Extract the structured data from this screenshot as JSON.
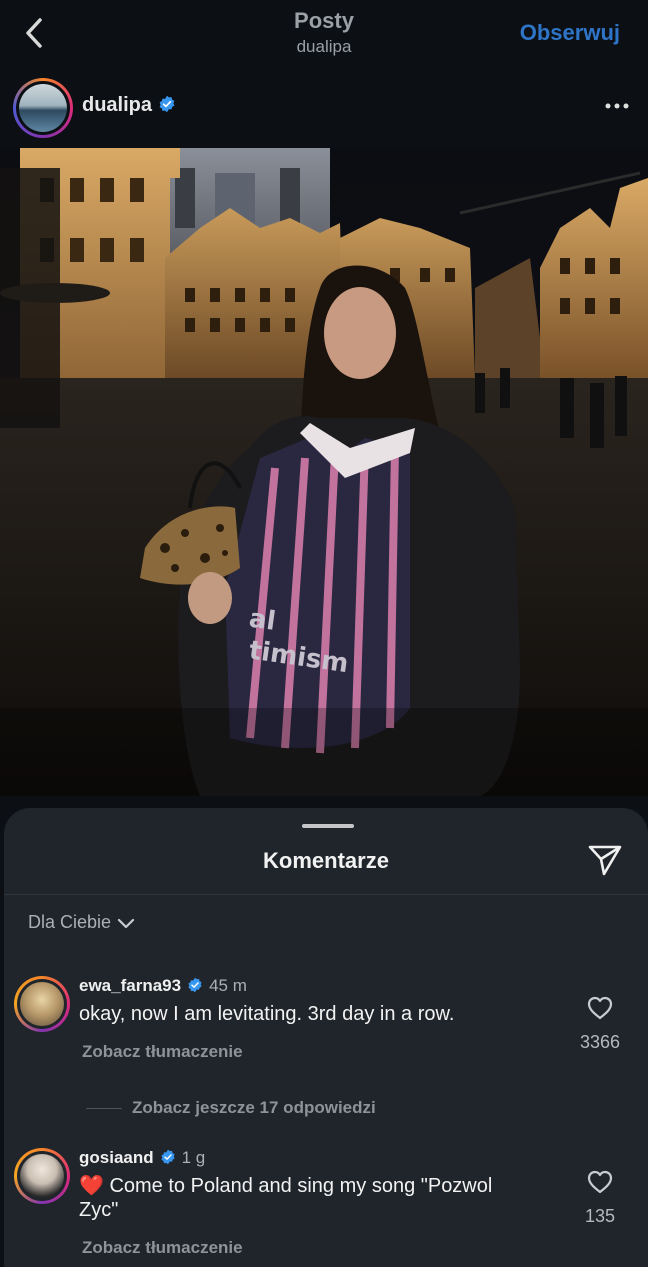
{
  "topbar": {
    "title": "Posty",
    "subtitle": "dualipa",
    "follow_label": "Obserwuj"
  },
  "post": {
    "username": "dualipa",
    "verified": true,
    "jersey_text": "al timism"
  },
  "comments_sheet": {
    "title": "Komentarze",
    "sort_label": "Dla Ciebie",
    "comments": [
      {
        "username": "ewa_farna93",
        "verified": true,
        "time": "45 m",
        "text": "okay, now I am levitating. 3rd day in a row.",
        "translate_label": "Zobacz tłumaczenie",
        "likes": "3366",
        "replies_label": "Zobacz jeszcze 17 odpowiedzi"
      },
      {
        "username": "gosiaand",
        "verified": true,
        "time": "1 g",
        "text": "❤️ Come to Poland and sing my song \"Pozwol Zyc\"",
        "translate_label": "Zobacz tłumaczenie",
        "likes": "135"
      }
    ]
  },
  "colors": {
    "background": "#0c0f14",
    "sheet": "#20252b",
    "accent_blue": "#2e74c7",
    "verified_blue": "#3797f0",
    "muted_text": "#8c939a"
  },
  "icons": [
    "back-chevron-icon",
    "verified-badge-icon",
    "more-dots-icon",
    "send-icon",
    "chevron-down-icon",
    "heart-icon"
  ]
}
